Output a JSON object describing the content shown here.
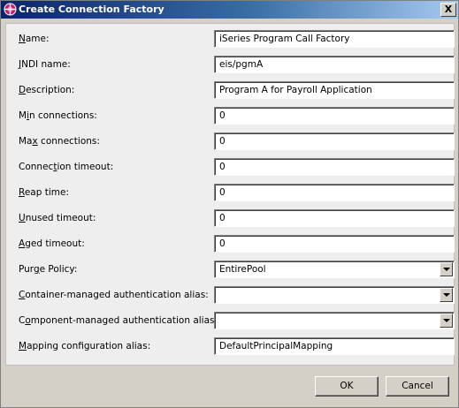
{
  "window": {
    "title": "Create Connection Factory",
    "close_label": "X"
  },
  "form": {
    "fields": [
      {
        "label": "Name:",
        "mnemonic": "N",
        "value": "iSeries Program Call Factory",
        "type": "text"
      },
      {
        "label": "JNDI name:",
        "mnemonic": "J",
        "value": "eis/pgmA",
        "type": "text"
      },
      {
        "label": "Description:",
        "mnemonic": "D",
        "value": "Program A for Payroll Application",
        "type": "text"
      },
      {
        "label": "Min connections:",
        "mnemonic": "i",
        "value": "0",
        "type": "text"
      },
      {
        "label": "Max connections:",
        "mnemonic": "x",
        "value": "0",
        "type": "text"
      },
      {
        "label": "Connection timeout:",
        "mnemonic": "t",
        "value": "0",
        "type": "text"
      },
      {
        "label": "Reap time:",
        "mnemonic": "R",
        "value": "0",
        "type": "text"
      },
      {
        "label": "Unused timeout:",
        "mnemonic": "U",
        "value": "0",
        "type": "text"
      },
      {
        "label": "Aged timeout:",
        "mnemonic": "A",
        "value": "0",
        "type": "text"
      },
      {
        "label": "Purge Policy:",
        "mnemonic": "g",
        "value": "EntirePool",
        "type": "select"
      },
      {
        "label": "Container-managed authentication alias:",
        "mnemonic": "C",
        "value": "",
        "type": "select"
      },
      {
        "label": "Component-managed authentication alias:",
        "mnemonic": "o",
        "value": "",
        "type": "select"
      },
      {
        "label": "Mapping configuration alias:",
        "mnemonic": "M",
        "value": "DefaultPrincipalMapping",
        "type": "text"
      }
    ]
  },
  "buttons": {
    "ok_label": "OK",
    "cancel_label": "Cancel"
  },
  "colors": {
    "titlebar_start": "#0a246a",
    "titlebar_end": "#a6caf0",
    "dialog_bg": "#d4d0c8",
    "panel_bg": "#eeeeee"
  },
  "icons": {
    "title_icon": "connection-factory-icon",
    "close_icon": "close-icon",
    "dropdown_icon": "chevron-down-icon"
  }
}
